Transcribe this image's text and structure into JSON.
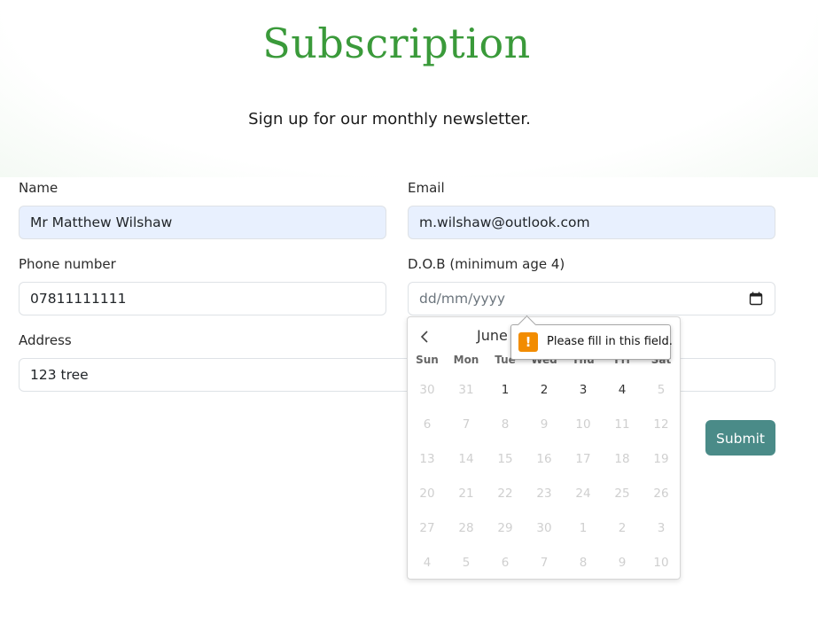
{
  "page": {
    "title": "Subscription",
    "subtitle": "Sign up for our monthly newsletter."
  },
  "form": {
    "name": {
      "label": "Name",
      "value": "Mr Matthew Wilshaw"
    },
    "email": {
      "label": "Email",
      "value": "m.wilshaw@outlook.com"
    },
    "phone": {
      "label": "Phone number",
      "value": "07811111111"
    },
    "dob": {
      "label": "D.O.B (minimum age 4)",
      "placeholder": "dd/mm/yyyy",
      "icon": "calendar-icon"
    },
    "address": {
      "label": "Address",
      "value": "123 tree"
    },
    "submit_label": "Submit"
  },
  "colors": {
    "title": "#3a9a3a",
    "submit": "#4a8b88",
    "autofill": "#e8f0fe",
    "warning": "#f28c00"
  },
  "calendar": {
    "month_label": "June",
    "weekdays": [
      "Sun",
      "Mon",
      "Tue",
      "Wed",
      "Thu",
      "Fri",
      "Sat"
    ],
    "weeks": [
      [
        {
          "d": "30",
          "cur": false
        },
        {
          "d": "31",
          "cur": false
        },
        {
          "d": "1",
          "cur": true
        },
        {
          "d": "2",
          "cur": true
        },
        {
          "d": "3",
          "cur": true
        },
        {
          "d": "4",
          "cur": true
        },
        {
          "d": "5",
          "cur": false
        }
      ],
      [
        {
          "d": "6",
          "cur": false
        },
        {
          "d": "7",
          "cur": false
        },
        {
          "d": "8",
          "cur": false
        },
        {
          "d": "9",
          "cur": false
        },
        {
          "d": "10",
          "cur": false
        },
        {
          "d": "11",
          "cur": false
        },
        {
          "d": "12",
          "cur": false
        }
      ],
      [
        {
          "d": "13",
          "cur": false
        },
        {
          "d": "14",
          "cur": false
        },
        {
          "d": "15",
          "cur": false
        },
        {
          "d": "16",
          "cur": false
        },
        {
          "d": "17",
          "cur": false
        },
        {
          "d": "18",
          "cur": false
        },
        {
          "d": "19",
          "cur": false
        }
      ],
      [
        {
          "d": "20",
          "cur": false
        },
        {
          "d": "21",
          "cur": false
        },
        {
          "d": "22",
          "cur": false
        },
        {
          "d": "23",
          "cur": false
        },
        {
          "d": "24",
          "cur": false
        },
        {
          "d": "25",
          "cur": false
        },
        {
          "d": "26",
          "cur": false
        }
      ],
      [
        {
          "d": "27",
          "cur": false
        },
        {
          "d": "28",
          "cur": false
        },
        {
          "d": "29",
          "cur": false
        },
        {
          "d": "30",
          "cur": false
        },
        {
          "d": "1",
          "cur": false
        },
        {
          "d": "2",
          "cur": false
        },
        {
          "d": "3",
          "cur": false
        }
      ],
      [
        {
          "d": "4",
          "cur": false
        },
        {
          "d": "5",
          "cur": false
        },
        {
          "d": "6",
          "cur": false
        },
        {
          "d": "7",
          "cur": false
        },
        {
          "d": "8",
          "cur": false
        },
        {
          "d": "9",
          "cur": false
        },
        {
          "d": "10",
          "cur": false
        }
      ]
    ]
  },
  "validation_tooltip": {
    "message": "Please fill in this field.",
    "icon": "warning-icon"
  }
}
